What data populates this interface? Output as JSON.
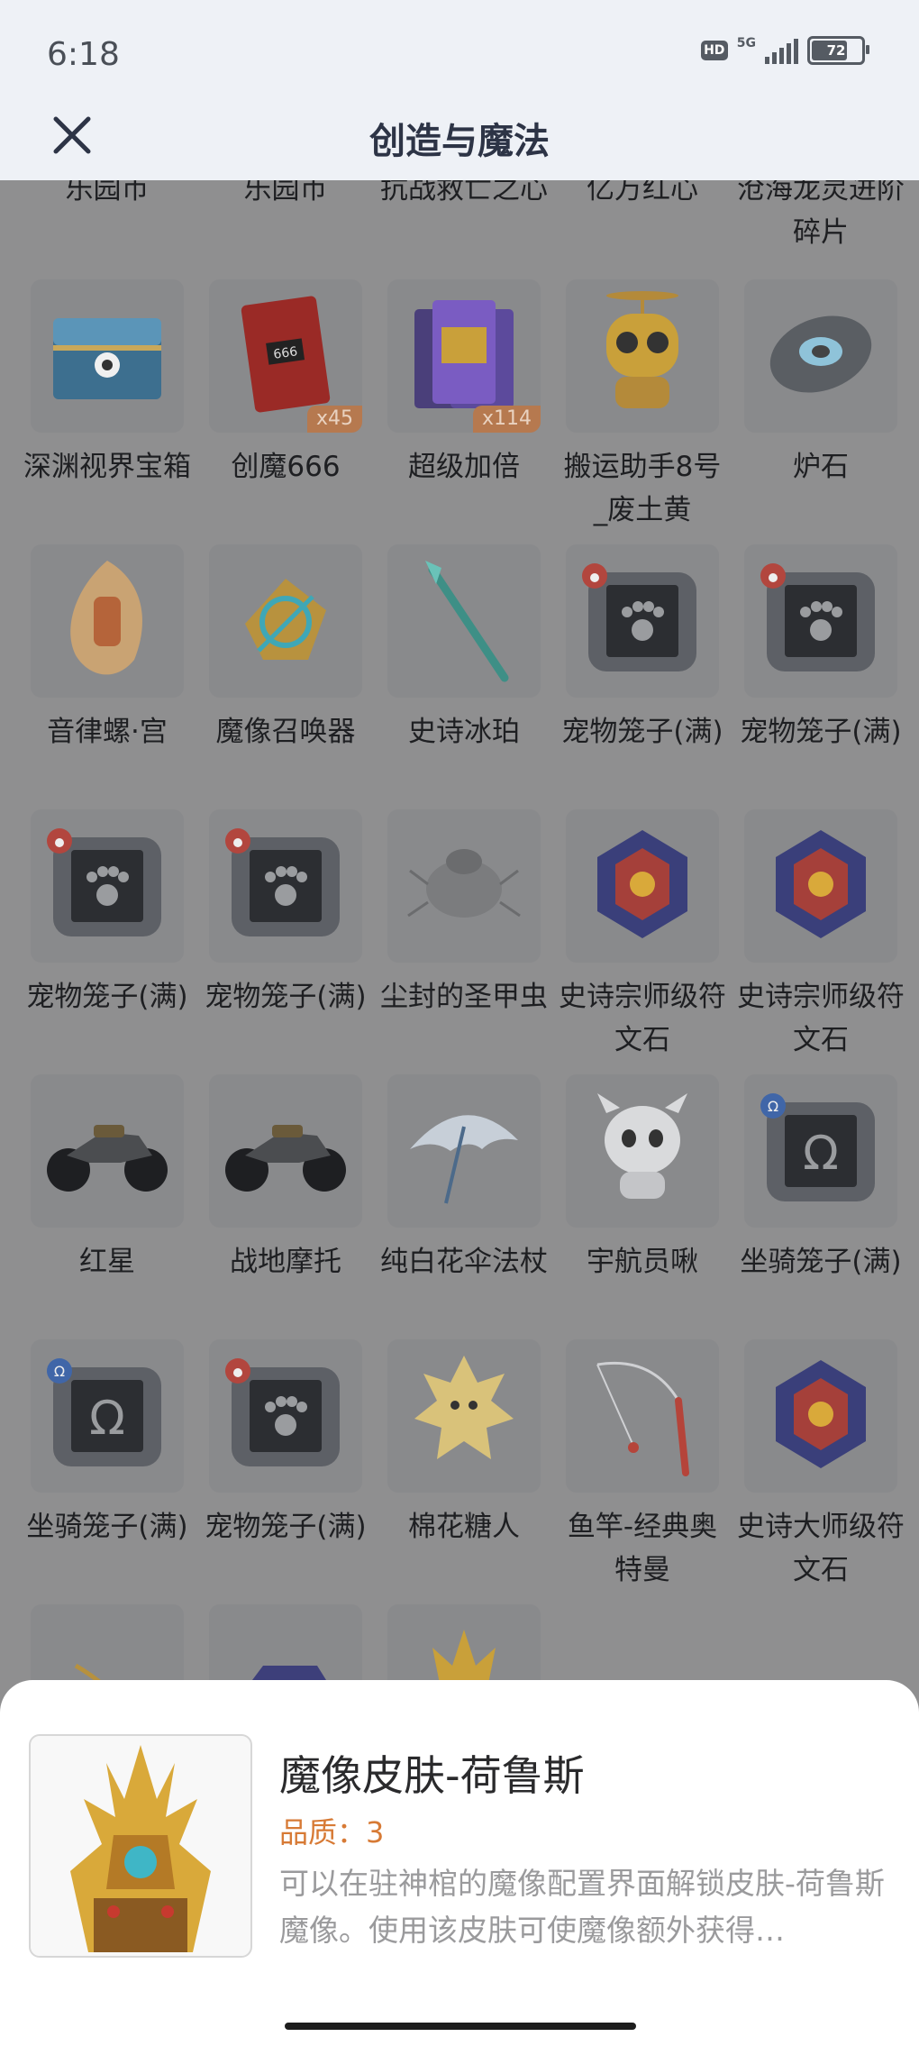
{
  "status": {
    "time": "6:18",
    "hd": "HD",
    "network": "5G",
    "battery": "72"
  },
  "header": {
    "title": "创造与魔法"
  },
  "partial_row": [
    "乐园币",
    "乐园币",
    "抗战救亡之心",
    "亿万红心",
    "沧海龙灵进阶碎片"
  ],
  "items": [
    {
      "label": "深渊视界宝箱",
      "icon": "treasure-chest-icon",
      "badge": ""
    },
    {
      "label": "创魔666",
      "icon": "card-666-icon",
      "badge": "x45"
    },
    {
      "label": "超级加倍",
      "icon": "card-pack-icon",
      "badge": "x114"
    },
    {
      "label": "搬运助手8号_废土黄",
      "icon": "robot-helper-icon",
      "badge": ""
    },
    {
      "label": "炉石",
      "icon": "hearthstone-icon",
      "badge": ""
    },
    {
      "label": "音律螺·宫",
      "icon": "conch-icon",
      "badge": ""
    },
    {
      "label": "魔像召唤器",
      "icon": "golem-summoner-icon",
      "badge": ""
    },
    {
      "label": "史诗冰珀",
      "icon": "ice-staff-icon",
      "badge": ""
    },
    {
      "label": "宠物笼子(满)",
      "icon": "pet-cage-icon",
      "badge": ""
    },
    {
      "label": "宠物笼子(满)",
      "icon": "pet-cage-icon",
      "badge": ""
    },
    {
      "label": "宠物笼子(满)",
      "icon": "pet-cage-icon",
      "badge": ""
    },
    {
      "label": "宠物笼子(满)",
      "icon": "pet-cage-icon",
      "badge": ""
    },
    {
      "label": "尘封的圣甲虫",
      "icon": "scarab-icon",
      "badge": ""
    },
    {
      "label": "史诗宗师级符文石",
      "icon": "rune-stone-icon",
      "badge": ""
    },
    {
      "label": "史诗宗师级符文石",
      "icon": "rune-stone-icon",
      "badge": ""
    },
    {
      "label": "红星",
      "icon": "motorcycle-icon",
      "badge": ""
    },
    {
      "label": "战地摩托",
      "icon": "motorcycle-icon",
      "badge": ""
    },
    {
      "label": "纯白花伞法杖",
      "icon": "umbrella-icon",
      "badge": ""
    },
    {
      "label": "宇航员啾",
      "icon": "astronaut-pet-icon",
      "badge": ""
    },
    {
      "label": "坐骑笼子(满)",
      "icon": "mount-cage-icon",
      "badge": ""
    },
    {
      "label": "坐骑笼子(满)",
      "icon": "mount-cage-icon",
      "badge": ""
    },
    {
      "label": "宠物笼子(满)",
      "icon": "pet-cage-icon",
      "badge": ""
    },
    {
      "label": "棉花糖人",
      "icon": "cotton-candy-creature-icon",
      "badge": ""
    },
    {
      "label": "鱼竿-经典奥特曼",
      "icon": "fishing-rod-icon",
      "badge": ""
    },
    {
      "label": "史诗大师级符文石",
      "icon": "rune-stone-icon",
      "badge": ""
    },
    {
      "label": "",
      "icon": "crossbow-icon",
      "badge": ""
    },
    {
      "label": "",
      "icon": "vehicle-icon",
      "badge": ""
    },
    {
      "label": "",
      "icon": "armor-skin-icon",
      "badge": ""
    }
  ],
  "detail": {
    "name": "魔像皮肤-荷鲁斯",
    "quality": "品质：3",
    "description": "可以在驻神棺的魔像配置界面解锁皮肤-荷鲁斯魔像。使用该皮肤可使魔像额外获得…",
    "icon": "horus-golem-skin-icon"
  },
  "colors": {
    "overlay_bg": "#8f8f90",
    "quality": "#d77a35",
    "badge": "#b6794f",
    "title": "#2d3446"
  }
}
